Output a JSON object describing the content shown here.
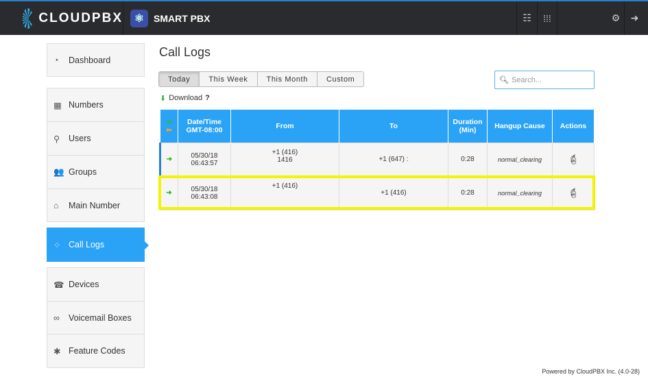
{
  "header": {
    "brand": "CLOUDPBX",
    "app": "SMART PBX"
  },
  "sidebar": [
    {
      "label": "Dashboard",
      "icon": "dashboard-icon"
    },
    {
      "label": "Numbers",
      "icon": "grid-icon"
    },
    {
      "label": "Users",
      "icon": "user-icon"
    },
    {
      "label": "Groups",
      "icon": "users-icon"
    },
    {
      "label": "Main Number",
      "icon": "home-icon"
    },
    {
      "label": "Call Logs",
      "icon": "call-logs-icon"
    },
    {
      "label": "Devices",
      "icon": "device-icon"
    },
    {
      "label": "Voicemail Boxes",
      "icon": "voicemail-icon"
    },
    {
      "label": "Feature Codes",
      "icon": "asterisk-icon"
    }
  ],
  "page": {
    "title": "Call Logs",
    "tabs": [
      "Today",
      "This Week",
      "This Month",
      "Custom"
    ],
    "download": "Download",
    "help": "?",
    "search_placeholder": "Search..."
  },
  "table": {
    "headers": [
      "Date/Time GMT-08:00",
      "From",
      "To",
      "Duration (Min)",
      "Hangup Cause",
      "Actions"
    ],
    "rows": [
      {
        "date": "05/30/18",
        "time": "06:43:57",
        "from1": "+1 (416)",
        "from2": "1416",
        "to": "+1 (647) :",
        "duration": "0:28",
        "cause": "normal_clearing"
      },
      {
        "date": "05/30/18",
        "time": "06:43:08",
        "from1": "+1 (416)",
        "from2": "",
        "to": "+1 (416)",
        "duration": "0:28",
        "cause": "normal_clearing"
      }
    ]
  },
  "footer": "Powered by CloudPBX Inc.  (4.0-28)"
}
